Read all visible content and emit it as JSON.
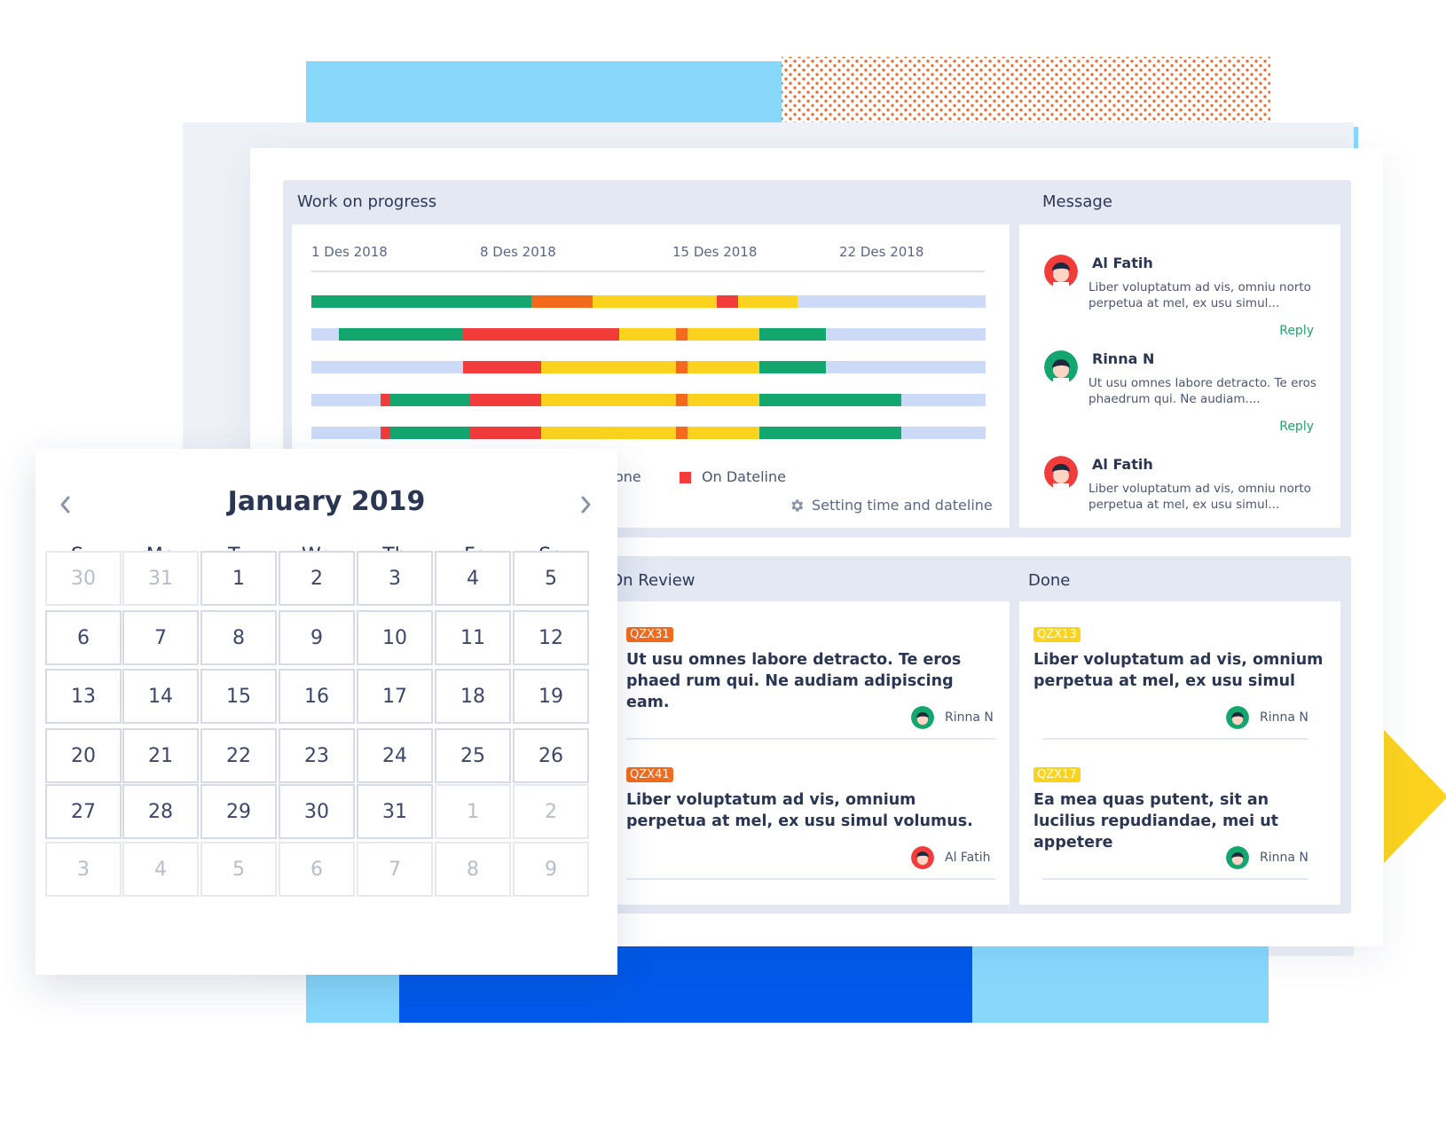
{
  "colors": {
    "green": "#13a66f",
    "orange": "#f26b1d",
    "yellow": "#fbd31f",
    "red": "#f23b3b",
    "track": "#ccdaf8",
    "panel": "#e3e8f3",
    "reply": "#21a56a"
  },
  "work_progress": {
    "title": "Work on progress",
    "dates": [
      "1 Des 2018",
      "8 Des 2018",
      "15 Des 2018",
      "22 Des 2018"
    ],
    "legend_done": "one",
    "legend_deadline": "On Dateline",
    "setting_label": "Setting time and dateline",
    "setting_icon": "gear-icon"
  },
  "message": {
    "title": "Message",
    "items": [
      {
        "name": "Al Fatih",
        "text": "Liber voluptatum ad vis, omniu norto perpetua at mel, ex usu simul...",
        "reply": "Reply"
      },
      {
        "name": "Rinna N",
        "text": "Ut usu omnes labore detracto. Te eros phaedrum qui. Ne audiam....",
        "reply": "Reply"
      },
      {
        "name": "Al Fatih",
        "text": "Liber voluptatum ad vis, omniu norto perpetua at mel, ex usu simul..."
      }
    ]
  },
  "on_review": {
    "title": "On Review",
    "tasks": [
      {
        "tag": "QZX31",
        "text": "Ut usu omnes labore detracto. Te eros phaed rum qui. Ne audiam adipiscing eam.",
        "user": "Rinna N"
      },
      {
        "tag": "QZX41",
        "text": "Liber voluptatum ad vis, omnium perpetua at mel, ex usu simul volumus.",
        "user": "Al Fatih"
      }
    ]
  },
  "done": {
    "title": "Done",
    "tasks": [
      {
        "tag": "QZX13",
        "text": "Liber voluptatum ad vis, omnium perpetua at mel, ex usu simul",
        "user": "Rinna N"
      },
      {
        "tag": "QZX17",
        "text": "Ea mea quas putent, sit an lucilius repudiandae, mei ut appetere",
        "user": "Rinna N"
      }
    ]
  },
  "calendar": {
    "title": "January 2019",
    "weekdays": [
      "Su",
      "Mo",
      "Tu",
      "We",
      "Th",
      "Fr",
      "Sa"
    ],
    "prev_icon": "chevron-left-icon",
    "next_icon": "chevron-right-icon",
    "weeks": [
      [
        "30",
        "31",
        "1",
        "2",
        "3",
        "4",
        "5"
      ],
      [
        "6",
        "7",
        "8",
        "9",
        "10",
        "11",
        "12"
      ],
      [
        "13",
        "14",
        "15",
        "16",
        "17",
        "18",
        "19"
      ],
      [
        "20",
        "21",
        "22",
        "23",
        "24",
        "25",
        "26"
      ],
      [
        "27",
        "28",
        "29",
        "30",
        "31",
        "1",
        "2"
      ],
      [
        "3",
        "4",
        "5",
        "6",
        "7",
        "8",
        "9"
      ]
    ],
    "outside_month": [
      [
        0,
        0
      ],
      [
        0,
        1
      ],
      [
        4,
        5
      ],
      [
        4,
        6
      ],
      [
        5,
        0
      ],
      [
        5,
        1
      ],
      [
        5,
        2
      ],
      [
        5,
        3
      ],
      [
        5,
        4
      ],
      [
        5,
        5
      ],
      [
        5,
        6
      ]
    ]
  }
}
